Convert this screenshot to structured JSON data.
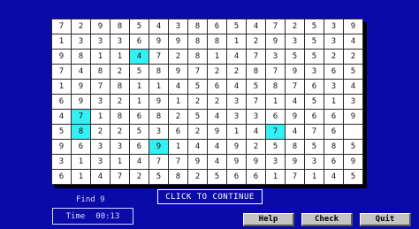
{
  "grid": {
    "rows": [
      [
        "7",
        "2",
        "9",
        "8",
        "5",
        "4",
        "3",
        "8",
        "6",
        "5",
        "4",
        "7",
        "2",
        "5",
        "3",
        "9"
      ],
      [
        "1",
        "3",
        "3",
        "3",
        "6",
        "9",
        "9",
        "8",
        "8",
        "1",
        "2",
        "9",
        "3",
        "5",
        "3",
        "4"
      ],
      [
        "9",
        "8",
        "1",
        "1",
        "4",
        "7",
        "2",
        "8",
        "1",
        "4",
        "7",
        "3",
        "5",
        "5",
        "2",
        "2"
      ],
      [
        "7",
        "4",
        "8",
        "2",
        "5",
        "8",
        "9",
        "7",
        "2",
        "2",
        "8",
        "7",
        "9",
        "3",
        "6",
        "5"
      ],
      [
        "1",
        "9",
        "7",
        "8",
        "1",
        "1",
        "4",
        "5",
        "6",
        "4",
        "5",
        "8",
        "7",
        "6",
        "3",
        "4"
      ],
      [
        "6",
        "9",
        "3",
        "2",
        "1",
        "9",
        "1",
        "2",
        "2",
        "3",
        "7",
        "1",
        "4",
        "5",
        "1",
        "3"
      ],
      [
        "4",
        "7",
        "1",
        "8",
        "6",
        "8",
        "2",
        "5",
        "4",
        "3",
        "3",
        "6",
        "9",
        "6",
        "6",
        "9"
      ],
      [
        "5",
        "8",
        "2",
        "2",
        "5",
        "3",
        "6",
        "2",
        "9",
        "1",
        "4",
        "7",
        "4",
        "7",
        "6"
      ],
      [
        "9",
        "6",
        "3",
        "3",
        "6",
        "9",
        "1",
        "4",
        "4",
        "9",
        "2",
        "5",
        "8",
        "5",
        "8",
        "5"
      ],
      [
        "3",
        "1",
        "3",
        "1",
        "4",
        "7",
        "7",
        "9",
        "4",
        "9",
        "9",
        "3",
        "9",
        "3",
        "6",
        "9"
      ],
      [
        "6",
        "1",
        "4",
        "7",
        "2",
        "5",
        "8",
        "2",
        "5",
        "6",
        "6",
        "1",
        "7",
        "1",
        "4",
        "5"
      ]
    ],
    "highlighted": [
      [
        2,
        4
      ],
      [
        6,
        1
      ],
      [
        7,
        1
      ],
      [
        7,
        11
      ],
      [
        8,
        5
      ]
    ]
  },
  "find_label": "Find 9",
  "continue_label": "CLICK TO CONTINUE",
  "timer": {
    "label": "Time",
    "value": "00:13"
  },
  "buttons": {
    "help": "Help",
    "check": "Check",
    "quit": "Quit"
  }
}
